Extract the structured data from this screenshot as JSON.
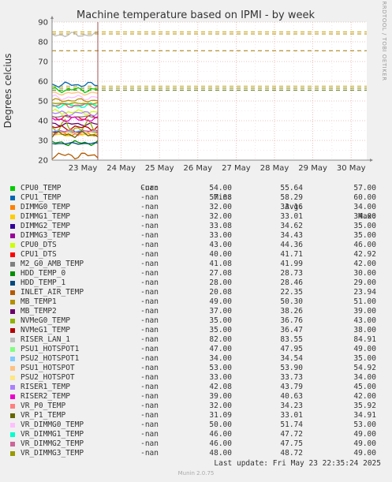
{
  "chart_data": {
    "type": "line",
    "title": "Machine temperature based on IPMI - by week",
    "ylabel": "Degrees celcius",
    "ylim": [
      20,
      90
    ],
    "yticks": [
      "20",
      "30",
      "40",
      "50",
      "60",
      "70",
      "80",
      "90"
    ],
    "xticks": [
      "23 May",
      "24 May",
      "25 May",
      "26 May",
      "27 May",
      "28 May",
      "29 May",
      "30 May"
    ],
    "grid": true,
    "thresholds": [
      {
        "value": 85,
        "color": "#c8a000"
      },
      {
        "value": 84,
        "color": "#b08800"
      },
      {
        "value": 75.5,
        "color": "#a07800"
      },
      {
        "value": 57.5,
        "color": "#c8a000"
      },
      {
        "value": 56.5,
        "color": "#808000"
      },
      {
        "value": 55.5,
        "color": "#507000"
      }
    ],
    "data_span_end": "23 May 22:35"
  },
  "side_label": "RRDTOOL / TOBI OETIKER",
  "legend_header": {
    "cur": "Cur:",
    "min": "Min:",
    "avg": "Avg:",
    "max": "Max:"
  },
  "series": [
    {
      "name": "CPU0_TEMP",
      "color": "#00cc00",
      "cur": "-nan",
      "min": "54.00",
      "avg": "55.64",
      "max": "57.00"
    },
    {
      "name": "CPU1_TEMP",
      "color": "#0066b3",
      "cur": "-nan",
      "min": "57.08",
      "avg": "58.29",
      "max": "60.00"
    },
    {
      "name": "DIMMG0_TEMP",
      "color": "#ff8000",
      "cur": "-nan",
      "min": "32.00",
      "avg": "33.16",
      "max": "34.00"
    },
    {
      "name": "DIMMG1_TEMP",
      "color": "#ffcc00",
      "cur": "-nan",
      "min": "32.00",
      "avg": "33.01",
      "max": "34.00"
    },
    {
      "name": "DIMMG2_TEMP",
      "color": "#330099",
      "cur": "-nan",
      "min": "33.08",
      "avg": "34.62",
      "max": "35.00"
    },
    {
      "name": "DIMMG3_TEMP",
      "color": "#990099",
      "cur": "-nan",
      "min": "33.00",
      "avg": "34.43",
      "max": "35.00"
    },
    {
      "name": "CPU0_DTS",
      "color": "#ccff00",
      "cur": "-nan",
      "min": "43.00",
      "avg": "44.36",
      "max": "46.00"
    },
    {
      "name": "CPU1_DTS",
      "color": "#ff0000",
      "cur": "-nan",
      "min": "40.00",
      "avg": "41.71",
      "max": "42.92"
    },
    {
      "name": "M2_G0_AMB_TEMP",
      "color": "#808080",
      "cur": "-nan",
      "min": "41.08",
      "avg": "41.99",
      "max": "42.00"
    },
    {
      "name": "HDD_TEMP_0",
      "color": "#008f00",
      "cur": "-nan",
      "min": "27.08",
      "avg": "28.73",
      "max": "30.00"
    },
    {
      "name": "HDD_TEMP_1",
      "color": "#00487d",
      "cur": "-nan",
      "min": "28.00",
      "avg": "28.46",
      "max": "29.00"
    },
    {
      "name": "INLET_AIR_TEMP",
      "color": "#b35a00",
      "cur": "-nan",
      "min": "20.08",
      "avg": "22.35",
      "max": "23.94"
    },
    {
      "name": "MB_TEMP1",
      "color": "#b38f00",
      "cur": "-nan",
      "min": "49.00",
      "avg": "50.30",
      "max": "51.00"
    },
    {
      "name": "MB_TEMP2",
      "color": "#6b006b",
      "cur": "-nan",
      "min": "37.00",
      "avg": "38.26",
      "max": "39.00"
    },
    {
      "name": "NVMeG0_TEMP",
      "color": "#8fb300",
      "cur": "-nan",
      "min": "35.00",
      "avg": "36.76",
      "max": "43.00"
    },
    {
      "name": "NVMeG1_TEMP",
      "color": "#b30000",
      "cur": "-nan",
      "min": "35.00",
      "avg": "36.47",
      "max": "38.00"
    },
    {
      "name": "RISER_LAN_1",
      "color": "#bebebe",
      "cur": "-nan",
      "min": "82.00",
      "avg": "83.55",
      "max": "84.91"
    },
    {
      "name": "PSU1_HOTSPOT1",
      "color": "#80ff80",
      "cur": "-nan",
      "min": "47.00",
      "avg": "47.95",
      "max": "49.00"
    },
    {
      "name": "PSU2_HOTSPOT1",
      "color": "#80c9ff",
      "cur": "-nan",
      "min": "34.00",
      "avg": "34.54",
      "max": "35.00"
    },
    {
      "name": "PSU1_HOTSPOT",
      "color": "#ffc080",
      "cur": "-nan",
      "min": "53.00",
      "avg": "53.90",
      "max": "54.92"
    },
    {
      "name": "PSU2_HOTSPOT",
      "color": "#ffe680",
      "cur": "-nan",
      "min": "33.00",
      "avg": "33.73",
      "max": "34.00"
    },
    {
      "name": "RISER1_TEMP",
      "color": "#aa80ff",
      "cur": "-nan",
      "min": "42.08",
      "avg": "43.79",
      "max": "45.00"
    },
    {
      "name": "RISER2_TEMP",
      "color": "#ee00cc",
      "cur": "-nan",
      "min": "39.00",
      "avg": "40.63",
      "max": "42.00"
    },
    {
      "name": "VR_P0_TEMP",
      "color": "#ff8080",
      "cur": "-nan",
      "min": "32.00",
      "avg": "34.23",
      "max": "35.92"
    },
    {
      "name": "VR_P1_TEMP",
      "color": "#666600",
      "cur": "-nan",
      "min": "31.09",
      "avg": "33.01",
      "max": "34.91"
    },
    {
      "name": "VR_DIMMG0_TEMP",
      "color": "#ffbfff",
      "cur": "-nan",
      "min": "50.00",
      "avg": "51.74",
      "max": "53.00"
    },
    {
      "name": "VR_DIMMG1_TEMP",
      "color": "#00ffcc",
      "cur": "-nan",
      "min": "46.00",
      "avg": "47.72",
      "max": "49.00"
    },
    {
      "name": "VR_DIMMG2_TEMP",
      "color": "#cc6699",
      "cur": "-nan",
      "min": "46.00",
      "avg": "47.75",
      "max": "49.00"
    },
    {
      "name": "VR_DIMMG3_TEMP",
      "color": "#999900",
      "cur": "-nan",
      "min": "48.00",
      "avg": "48.72",
      "max": "49.00"
    }
  ],
  "last_update": "Last update: Fri May 23 22:35:24 2025",
  "munin_version": "Munin 2.0.75"
}
